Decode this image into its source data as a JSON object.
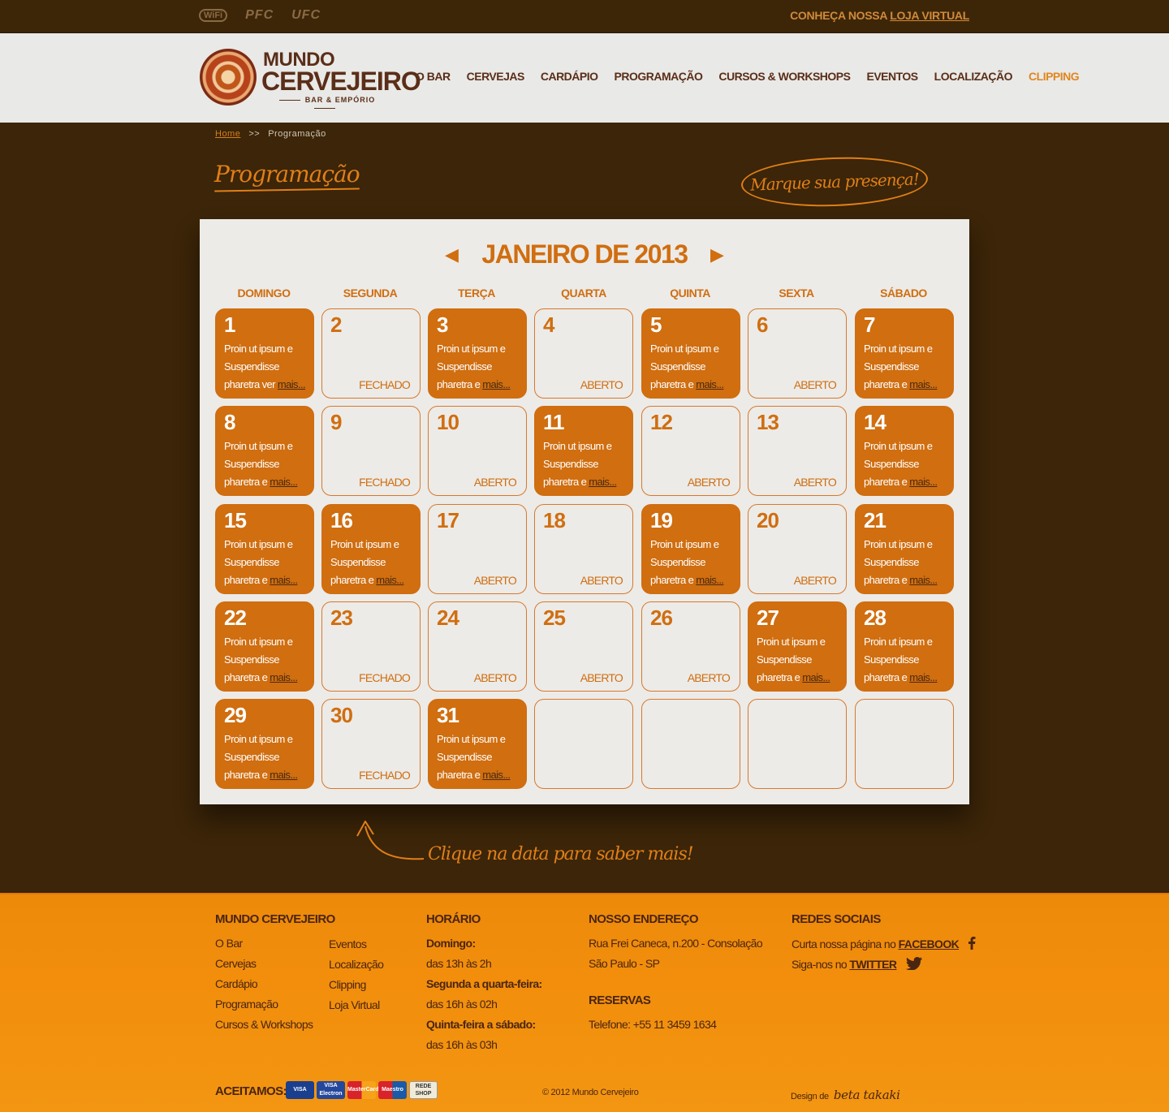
{
  "topbar": {
    "logos": [
      "WiFi",
      "PFC",
      "UFC"
    ],
    "store_prefix": "CONHEÇA NOSSA ",
    "store_link": "LOJA VIRTUAL"
  },
  "brand": {
    "line1": "MUNDO",
    "line2": "CERVEJEIRO",
    "tagline": "BAR & EMPÓRIO"
  },
  "nav": [
    "O BAR",
    "CERVEJAS",
    "CARDÁPIO",
    "PROGRAMAÇÃO",
    "CURSOS & WORKSHOPS",
    "EVENTOS",
    "LOCALIZAÇÃO",
    "CLIPPING"
  ],
  "breadcrumb": {
    "home": "Home",
    "separator": ">>",
    "current": "Programação"
  },
  "page_title": "Programação",
  "presence_button": "Marque sua presença!",
  "calendar": {
    "month": "JANEIRO DE 2013",
    "prev_arrow": "◀",
    "next_arrow": "▶",
    "weekdays": [
      "DOMINGO",
      "SEGUNDA",
      "TERÇA",
      "QUARTA",
      "QUINTA",
      "SEXTA",
      "SÁBADO"
    ],
    "days": [
      {
        "day": "1",
        "event": true,
        "lines": [
          "Proin ut ipsum e",
          "Suspendisse",
          "pharetra ver "
        ],
        "more": "mais..."
      },
      {
        "day": "2",
        "event": false,
        "status": "FECHADO"
      },
      {
        "day": "3",
        "event": true,
        "lines": [
          "Proin ut ipsum e",
          "Suspendisse",
          "pharetra e "
        ],
        "more": "mais..."
      },
      {
        "day": "4",
        "event": false,
        "status": "ABERTO"
      },
      {
        "day": "5",
        "event": true,
        "lines": [
          "Proin ut ipsum e",
          "Suspendisse",
          "pharetra e "
        ],
        "more": "mais..."
      },
      {
        "day": "6",
        "event": false,
        "status": "ABERTO"
      },
      {
        "day": "7",
        "event": true,
        "lines": [
          "Proin ut ipsum e",
          "Suspendisse",
          "pharetra e "
        ],
        "more": "mais..."
      },
      {
        "day": "8",
        "event": true,
        "lines": [
          "Proin ut ipsum e",
          "Suspendisse",
          "pharetra e "
        ],
        "more": "mais..."
      },
      {
        "day": "9",
        "event": false,
        "status": "FECHADO"
      },
      {
        "day": "10",
        "event": false,
        "status": "ABERTO"
      },
      {
        "day": "11",
        "event": true,
        "lines": [
          "Proin ut ipsum e",
          "Suspendisse",
          "pharetra e "
        ],
        "more": "mais..."
      },
      {
        "day": "12",
        "event": false,
        "status": "ABERTO"
      },
      {
        "day": "13",
        "event": false,
        "status": "ABERTO"
      },
      {
        "day": "14",
        "event": true,
        "lines": [
          "Proin ut ipsum e",
          "Suspendisse",
          "pharetra e "
        ],
        "more": "mais..."
      },
      {
        "day": "15",
        "event": true,
        "lines": [
          "Proin ut ipsum e",
          "Suspendisse",
          "pharetra e "
        ],
        "more": "mais..."
      },
      {
        "day": "16",
        "event": true,
        "lines": [
          "Proin ut ipsum e",
          "Suspendisse",
          "pharetra e "
        ],
        "more": "mais..."
      },
      {
        "day": "17",
        "event": false,
        "status": "ABERTO"
      },
      {
        "day": "18",
        "event": false,
        "status": "ABERTO"
      },
      {
        "day": "19",
        "event": true,
        "lines": [
          "Proin ut ipsum e",
          "Suspendisse",
          "pharetra e "
        ],
        "more": "mais..."
      },
      {
        "day": "20",
        "event": false,
        "status": "ABERTO"
      },
      {
        "day": "21",
        "event": true,
        "lines": [
          "Proin ut ipsum e",
          "Suspendisse",
          "pharetra e "
        ],
        "more": "mais..."
      },
      {
        "day": "22",
        "event": true,
        "lines": [
          "Proin ut ipsum e",
          "Suspendisse",
          "pharetra e "
        ],
        "more": "mais..."
      },
      {
        "day": "23",
        "event": false,
        "status": "FECHADO"
      },
      {
        "day": "24",
        "event": false,
        "status": "ABERTO"
      },
      {
        "day": "25",
        "event": false,
        "status": "ABERTO"
      },
      {
        "day": "26",
        "event": false,
        "status": "ABERTO"
      },
      {
        "day": "27",
        "event": true,
        "lines": [
          "Proin ut ipsum e",
          "Suspendisse",
          "pharetra e "
        ],
        "more": "mais..."
      },
      {
        "day": "28",
        "event": true,
        "lines": [
          "Proin ut ipsum e",
          "Suspendisse",
          "pharetra e "
        ],
        "more": "mais..."
      },
      {
        "day": "29",
        "event": true,
        "lines": [
          "Proin ut ipsum e",
          "Suspendisse",
          "pharetra e "
        ],
        "more": "mais..."
      },
      {
        "day": "30",
        "event": false,
        "status": "FECHADO"
      },
      {
        "day": "31",
        "event": true,
        "lines": [
          "Proin ut ipsum e",
          "Suspendisse",
          "pharetra e "
        ],
        "more": "mais..."
      },
      {
        "day": "",
        "event": false
      },
      {
        "day": "",
        "event": false
      },
      {
        "day": "",
        "event": false
      },
      {
        "day": "",
        "event": false
      }
    ]
  },
  "hint": "Clique na data para saber mais!",
  "footer": {
    "col1_title": "MUNDO CERVEJEIRO",
    "col1_links_a": [
      "O Bar",
      "Cervejas",
      "Cardápio",
      "Programação",
      "Cursos & Workshops"
    ],
    "col1_links_b": [
      "Eventos",
      "Localização",
      "Clipping",
      "Loja Virtual"
    ],
    "hours_title": "HORÁRIO",
    "hours": [
      {
        "label": "Domingo:",
        "value": "das 13h às 2h"
      },
      {
        "label": "Segunda a quarta-feira:",
        "value": "das 16h às 02h"
      },
      {
        "label": "Quinta-feira a sábado:",
        "value": "das 16h às 03h"
      }
    ],
    "address_title": "NOSSO ENDEREÇO",
    "address_lines": [
      "Rua Frei Caneca, n.200 - Consolação",
      "São Paulo - SP"
    ],
    "reservas_title": "RESERVAS",
    "phone": "Telefone: +55 11 3459 1634",
    "social_title": "REDES SOCIAIS",
    "facebook_prefix": "Curta nossa página no ",
    "facebook_link": "FACEBOOK",
    "twitter_prefix": "Siga-nos no ",
    "twitter_link": "TWITTER",
    "accept_label": "ACEITAMOS:",
    "cards": [
      "VISA",
      "VISA Electron",
      "MasterCard",
      "Maestro",
      "REDE SHOP"
    ],
    "copyright": "© 2012 Mundo Cervejeiro",
    "design_prefix": "Design de",
    "design_sig": "beta takaki"
  },
  "colors": {
    "brown_bg": "#3c2508",
    "orange": "#d06e10",
    "footer_orange": "#f28e0c",
    "header_gray": "#e9e9e7"
  }
}
